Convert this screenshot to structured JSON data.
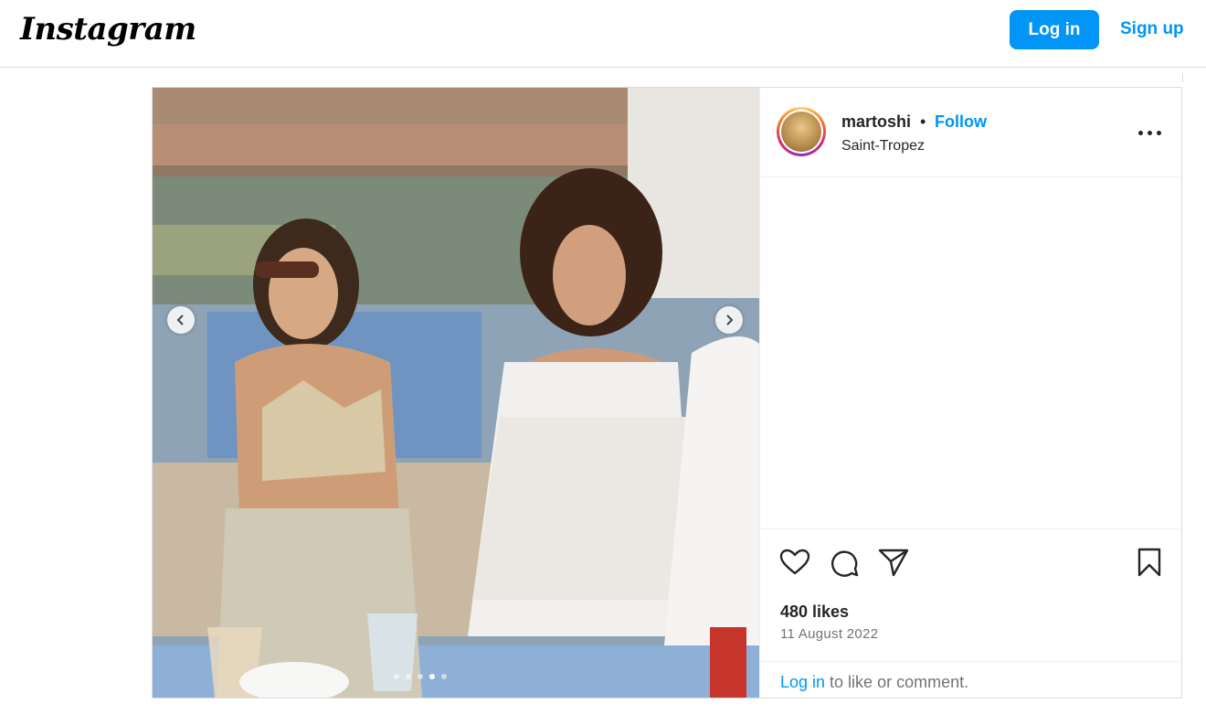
{
  "nav": {
    "logo": "Instagram",
    "login_label": "Log in",
    "signup_label": "Sign up"
  },
  "post": {
    "username": "martoshi",
    "separator": "•",
    "follow_label": "Follow",
    "location": "Saint-Tropez",
    "likes": "480 likes",
    "date": "11 August 2022",
    "carousel_dots": 5,
    "footer": {
      "login_link": "Log in",
      "rest": " to like or comment."
    }
  },
  "icons": [
    "more-options-icon",
    "heart-icon",
    "comment-icon",
    "share-icon",
    "bookmark-icon",
    "chevron-left-icon",
    "chevron-right-icon"
  ],
  "colors": {
    "accent": "#0095f6",
    "text": "#262626",
    "muted": "#737373",
    "border": "#dbdbdb"
  }
}
